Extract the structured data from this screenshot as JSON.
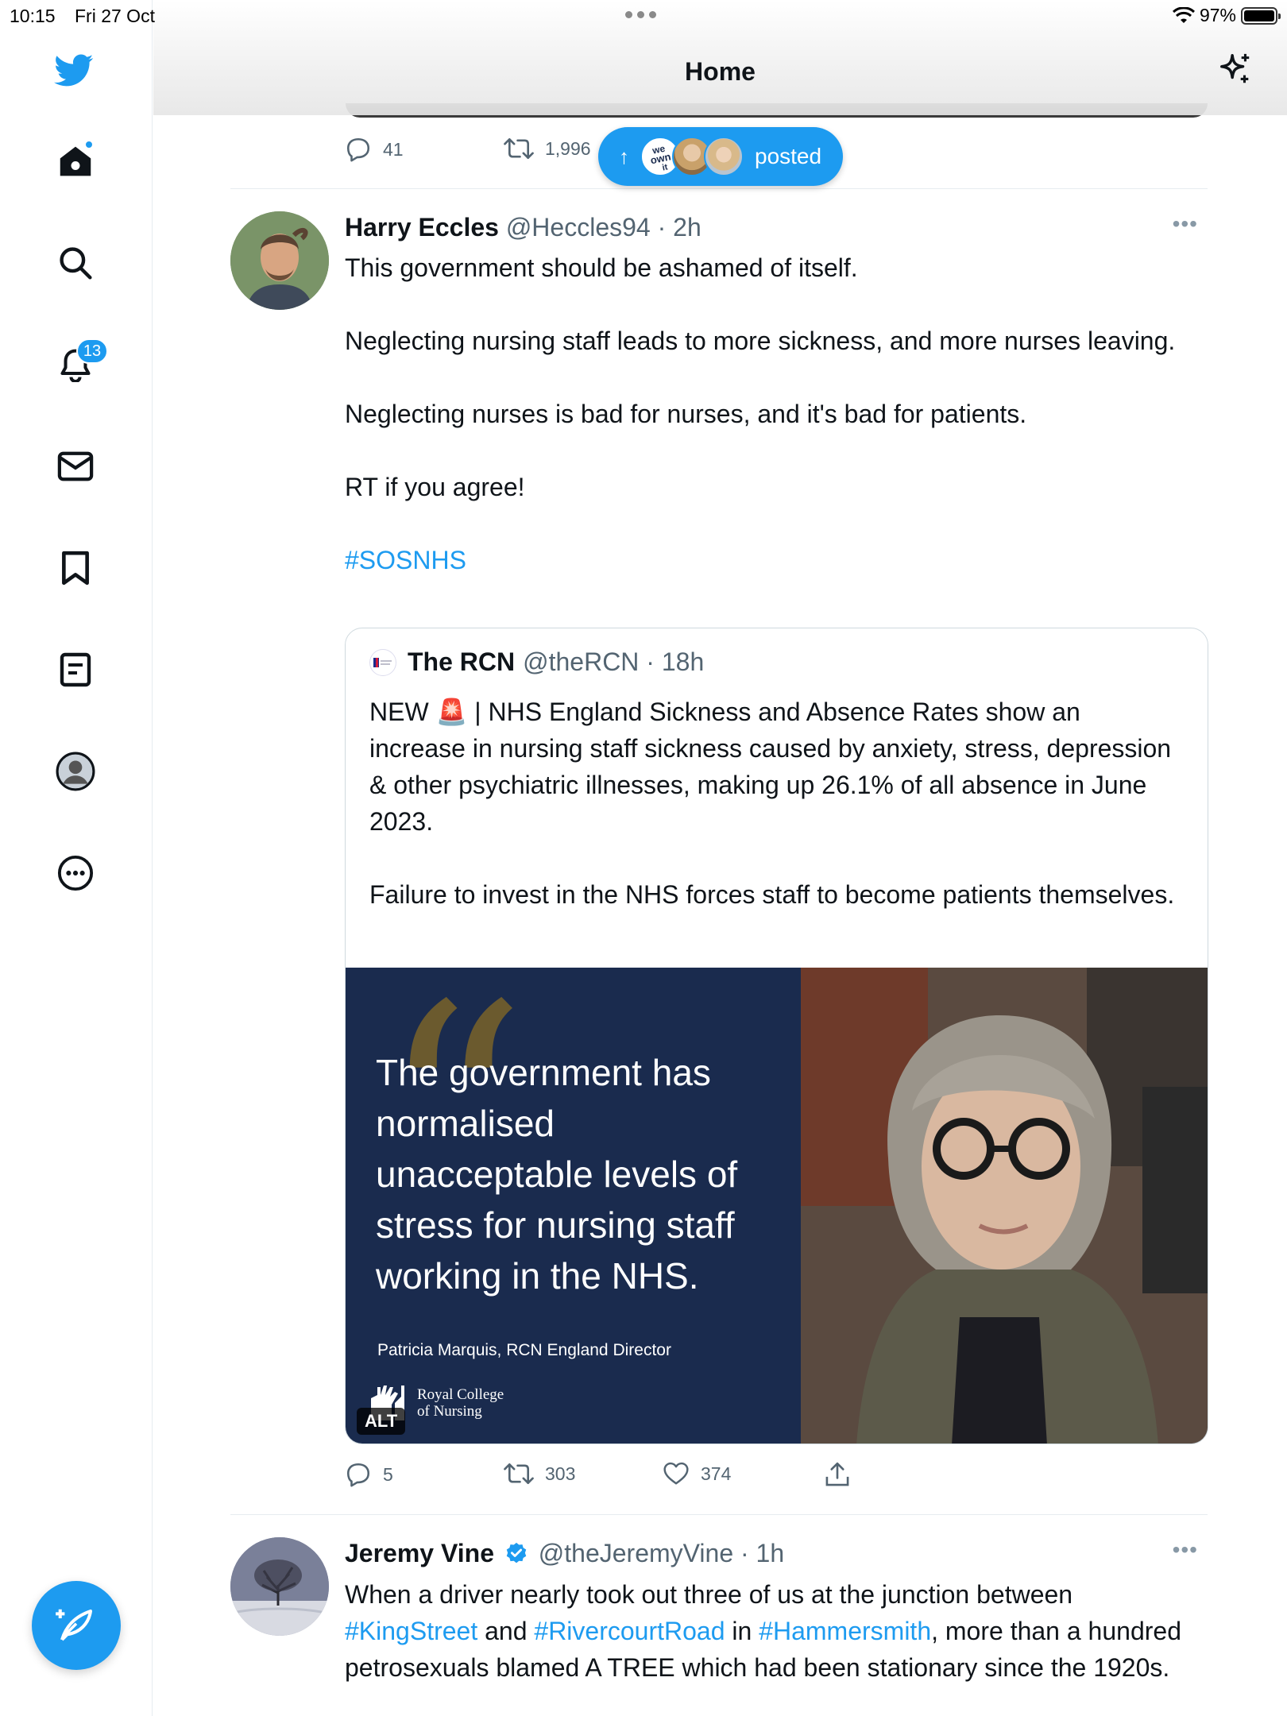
{
  "status_bar": {
    "time": "10:15",
    "date": "Fri 27 Oct",
    "battery": "97%"
  },
  "header": {
    "title": "Home"
  },
  "sidebar": {
    "notifications_count": "13"
  },
  "new_posts_pill": {
    "label": "posted"
  },
  "prev_tweet_actions": {
    "replies": "41",
    "retweets": "1,996"
  },
  "tweet1": {
    "name": "Harry Eccles",
    "handle": "@Heccles94",
    "time": "2h",
    "paragraphs": [
      "This government should be ashamed of itself.",
      "Neglecting nursing staff leads to more sickness, and more nurses leaving.",
      "Neglecting nurses is bad for nurses, and it's bad for patients.",
      "RT if you agree!"
    ],
    "hashtag": "#SOSNHS",
    "quoted": {
      "name": "The RCN",
      "handle": "@theRCN",
      "time": "18h",
      "text_prefix": "NEW",
      "text_emoji": "🚨",
      "text_main": " | NHS England Sickness and Absence Rates show an increase in nursing staff sickness caused by anxiety, stress, depression & other psychiatric illnesses, making up 26.1% of all absence in June 2023.",
      "text_para2": "Failure to invest in the NHS forces staff to become patients themselves.",
      "image": {
        "quote": "The government has normalised unacceptable levels of stress for nursing staff working in the NHS.",
        "attribution": "Patricia Marquis, RCN England Director",
        "logo_line1": "Royal College",
        "logo_line2": "of Nursing",
        "alt_badge": "ALT"
      }
    },
    "actions": {
      "replies": "5",
      "retweets": "303",
      "likes": "374"
    }
  },
  "tweet2": {
    "name": "Jeremy Vine",
    "handle": "@theJeremyVine",
    "time": "1h",
    "text_1": "When a driver nearly took out three of us at the junction between ",
    "link_1": "#KingStreet",
    "text_2": " and ",
    "link_2": "#RivercourtRoad",
    "text_3": " in ",
    "link_3": "#Hammersmith",
    "text_4": ", more than a hundred petrosexuals blamed A TREE which had been stationary since the 1920s."
  },
  "colors": {
    "accent": "#1d9bf0",
    "text": "#0f1419",
    "secondary": "#536471"
  }
}
